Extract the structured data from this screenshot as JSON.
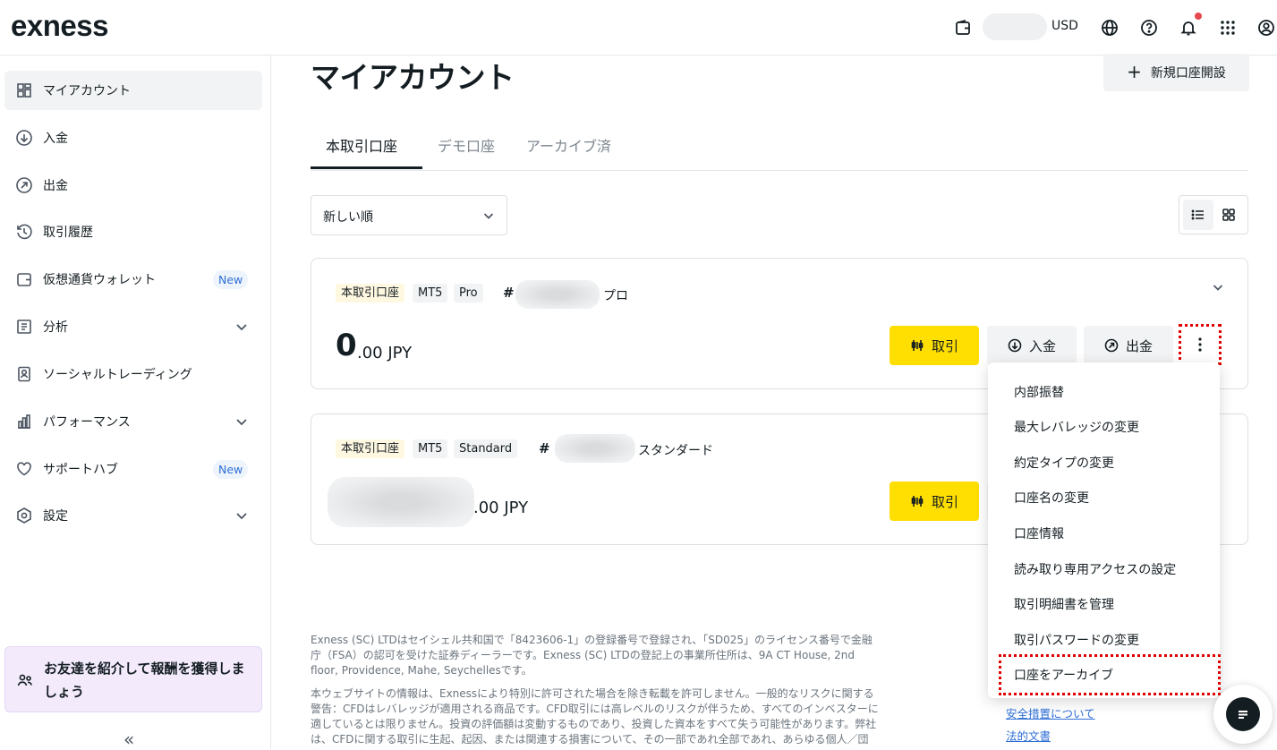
{
  "header": {
    "logo": "exness",
    "currency": "USD",
    "icons": [
      "wallet-icon",
      "globe-icon",
      "help-icon",
      "bell-icon",
      "apps-grid-icon",
      "profile-icon"
    ]
  },
  "sidebar": {
    "items": [
      {
        "label": "マイアカウント",
        "icon": "dashboard-icon"
      },
      {
        "label": "入金",
        "icon": "deposit-icon"
      },
      {
        "label": "出金",
        "icon": "withdraw-icon"
      },
      {
        "label": "取引履歴",
        "icon": "history-icon"
      },
      {
        "label": "仮想通貨ウォレット",
        "icon": "crypto-wallet-icon",
        "badge": "New"
      },
      {
        "label": "分析",
        "icon": "analytics-icon"
      },
      {
        "label": "ソーシャルトレーディング",
        "icon": "social-trading-icon"
      },
      {
        "label": "パフォーマンス",
        "icon": "performance-icon"
      },
      {
        "label": "サポートハブ",
        "icon": "heart-icon",
        "badge": "New"
      },
      {
        "label": "設定",
        "icon": "settings-icon"
      }
    ],
    "refer": "お友達を紹介して報酬を獲得しましょう",
    "collapse": "«"
  },
  "main": {
    "title": "マイアカウント",
    "new_account": "新規口座開設",
    "tabs": [
      "本取引口座",
      "デモ口座",
      "アーカイブ済"
    ],
    "sort_value": "新しい順"
  },
  "accounts": [
    {
      "type_tag": "本取引口座",
      "platform": "MT5",
      "kind": "Pro",
      "hash": "#",
      "name": "プロ",
      "balance_int": "0",
      "balance_dec": ".00 JPY",
      "trade": "取引",
      "deposit": "入金",
      "withdraw": "出金"
    },
    {
      "type_tag": "本取引口座",
      "platform": "MT5",
      "kind": "Standard",
      "hash": "#",
      "name": "スタンダード",
      "balance_dec": ".00 JPY",
      "trade": "取引"
    }
  ],
  "menu": [
    "内部振替",
    "最大レバレッジの変更",
    "約定タイプの変更",
    "口座名の変更",
    "口座情報",
    "読み取り専用アクセスの設定",
    "取引明細書を管理",
    "取引パスワードの変更",
    "口座をアーカイブ"
  ],
  "footer": {
    "p1": "Exness (SC) LTDはセイシェル共和国で「8423606-1」の登録番号で登録され、「SD025」のライセンス番号で金融庁（FSA）の認可を受けた証券ディーラーです。Exness (SC) LTDの登記上の事業所住所は、9A CT House, 2nd floor, Providence, Mahe, Seychellesです。",
    "p2": "本ウェブサイトの情報は、Exnessにより特別に許可された場合を除き転載を許可しません。一般的なリスクに関する警告：CFDはレバレッジが適用される商品です。CFD取引には高レベルのリスクが伴うため、すべてのインベスターに適しているとは限りません。投資の評価額は変動するものであり、投資した資本をすべて失う可能性があります。弊社は、CFDに関する取引に生起、起因、または関連する損害について、その一部であれ全部であれ、あらゆる個人／団体に",
    "links": [
      "安全措置について",
      "法的文書"
    ]
  }
}
